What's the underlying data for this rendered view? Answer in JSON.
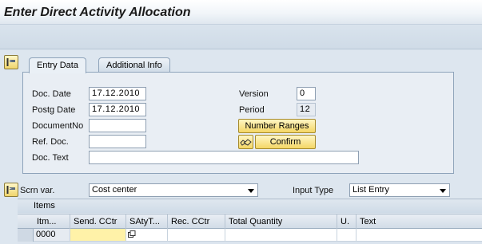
{
  "window": {
    "title": "Enter Direct Activity Allocation"
  },
  "tabs": [
    {
      "label": "Entry Data",
      "active": true
    },
    {
      "label": "Additional Info",
      "active": false
    }
  ],
  "header_fields": {
    "doc_date": {
      "label": "Doc. Date",
      "value": "17.12.2010"
    },
    "postg_date": {
      "label": "Postg Date",
      "value": "17.12.2010"
    },
    "document_no": {
      "label": "DocumentNo",
      "value": ""
    },
    "ref_doc": {
      "label": "Ref. Doc.",
      "value": ""
    },
    "doc_text": {
      "label": "Doc. Text",
      "value": ""
    },
    "version": {
      "label": "Version",
      "value": "0"
    },
    "period": {
      "label": "Period",
      "value": "12"
    }
  },
  "buttons": {
    "number_ranges": "Number Ranges",
    "confirm": "Confirm"
  },
  "screen_variant": {
    "label": "Scrn var.",
    "value": "Cost center"
  },
  "input_type": {
    "label": "Input Type",
    "value": "List Entry"
  },
  "items": {
    "title": "Items",
    "columns": [
      "Itm...",
      "Send. CCtr",
      "SAtyT...",
      "Rec. CCtr",
      "Total Quantity",
      "U.",
      "Text"
    ],
    "rows": [
      {
        "item": "0000",
        "send_cctr": "",
        "sactyt": "",
        "rec_cctr": "",
        "total_quantity": "",
        "unit": "",
        "text": ""
      }
    ]
  },
  "colors": {
    "background": "#dde6ef",
    "button_yellow": "#f4d665",
    "active_cell": "#fff2a8"
  }
}
